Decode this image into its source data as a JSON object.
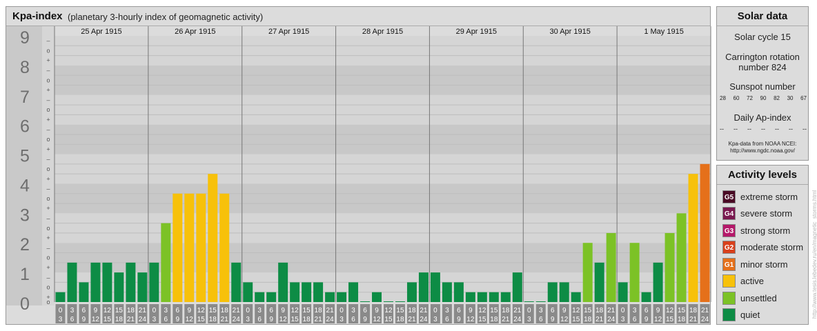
{
  "header": {
    "title": "Kpa-index",
    "subtitle": "(planetary 3-hourly index of geomagnetic activity)"
  },
  "solar": {
    "title": "Solar data",
    "solar_cycle": "Solar cycle 15",
    "carrington_line1": "Carrington rotation",
    "carrington_line2": "number 824",
    "sunspot_title": "Sunspot number",
    "sunspot_values": [
      "28",
      "60",
      "72",
      "90",
      "82",
      "30",
      "67"
    ],
    "ap_title": "Daily Ap-index",
    "ap_values": [
      "--",
      "--",
      "--",
      "--",
      "--",
      "--",
      "--"
    ],
    "source_line1": "Kpa-data from NOAA NCEI:",
    "source_line2": "http://www.ngdc.noaa.gov/"
  },
  "activity": {
    "title": "Activity levels",
    "levels": [
      {
        "badge": "G5",
        "label": "extreme storm",
        "color": "#4a0a25"
      },
      {
        "badge": "G4",
        "label": "severe storm",
        "color": "#7a1850"
      },
      {
        "badge": "G3",
        "label": "strong storm",
        "color": "#b5186a"
      },
      {
        "badge": "G2",
        "label": "moderate storm",
        "color": "#d8401c"
      },
      {
        "badge": "G1",
        "label": "minor storm",
        "color": "#e5701a"
      },
      {
        "badge": "",
        "label": "active",
        "color": "#f7c10a"
      },
      {
        "badge": "",
        "label": "unsettled",
        "color": "#7cc226"
      },
      {
        "badge": "",
        "label": "quiet",
        "color": "#0d8c45"
      }
    ]
  },
  "watermark": "http://www.tesis.lebedev.ru/en/magnetic_storms.html",
  "chart_data": {
    "type": "bar",
    "ylim": [
      0,
      9
    ],
    "y_ticks": [
      "0",
      "1",
      "2",
      "3",
      "4",
      "5",
      "6",
      "7",
      "8",
      "9"
    ],
    "sub_ticks": [
      "+",
      "o",
      "–"
    ],
    "days": [
      "25 Apr 1915",
      "26 Apr 1915",
      "27 Apr 1915",
      "28 Apr 1915",
      "29 Apr 1915",
      "30 Apr 1915",
      "1 May 1915"
    ],
    "interval_starts": [
      "0",
      "3",
      "6",
      "9",
      "12",
      "15",
      "18",
      "21"
    ],
    "interval_ends": [
      "3",
      "6",
      "9",
      "12",
      "15",
      "18",
      "21",
      "24"
    ],
    "series": [
      {
        "values": [
          0.333,
          1.333,
          0.667,
          1.333,
          1.333,
          1.0,
          1.333,
          1.0,
          1.333,
          2.667,
          3.667,
          3.667,
          3.667,
          4.333,
          3.667,
          1.333,
          0.667,
          0.333,
          0.333,
          1.333,
          0.667,
          0.667,
          0.667,
          0.333,
          0.333,
          0.667,
          0.0,
          0.333,
          0.0,
          0.0,
          0.667,
          1.0,
          1.0,
          0.667,
          0.667,
          0.333,
          0.333,
          0.333,
          0.333,
          1.0,
          0.0,
          0.0,
          0.667,
          0.667,
          0.333,
          2.0,
          1.333,
          2.333,
          0.667,
          2.0,
          0.333,
          1.333,
          2.333,
          3.0,
          4.333,
          4.667
        ]
      }
    ],
    "legend": "right"
  }
}
